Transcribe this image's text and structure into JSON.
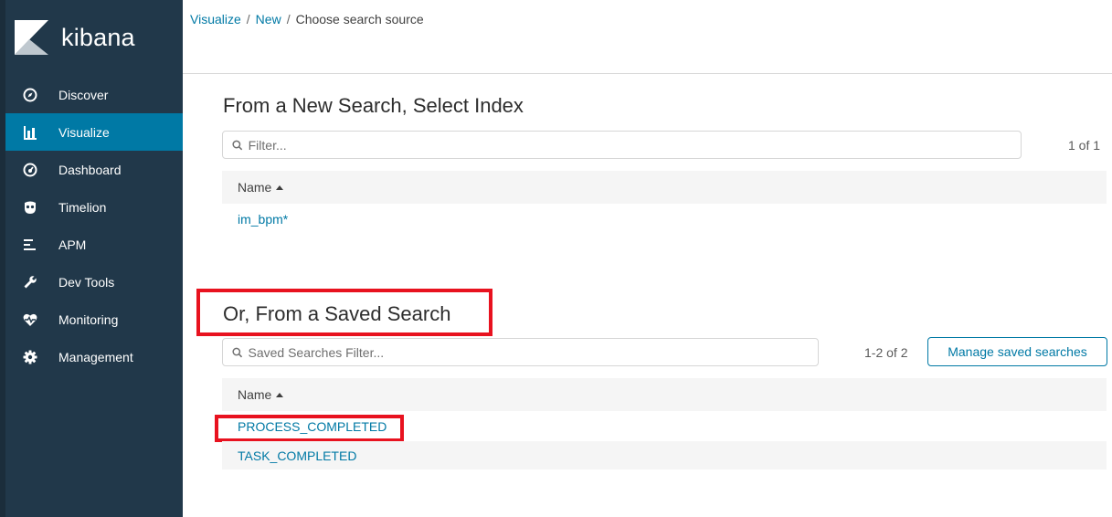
{
  "app": {
    "name": "kibana"
  },
  "sidebar": {
    "items": [
      {
        "label": "Discover",
        "icon": "compass-icon",
        "active": false
      },
      {
        "label": "Visualize",
        "icon": "bar-chart-icon",
        "active": true
      },
      {
        "label": "Dashboard",
        "icon": "dashboard-gauge-icon",
        "active": false
      },
      {
        "label": "Timelion",
        "icon": "timelion-mask-icon",
        "active": false
      },
      {
        "label": "APM",
        "icon": "apm-lines-icon",
        "active": false
      },
      {
        "label": "Dev Tools",
        "icon": "wrench-icon",
        "active": false
      },
      {
        "label": "Monitoring",
        "icon": "heartbeat-icon",
        "active": false
      },
      {
        "label": "Management",
        "icon": "gear-icon",
        "active": false
      }
    ]
  },
  "breadcrumb": {
    "items": [
      "Visualize",
      "New",
      "Choose search source"
    ],
    "separator": "/"
  },
  "new_search": {
    "title": "From a New Search, Select Index",
    "filter_placeholder": "Filter...",
    "count": "1 of 1",
    "column_header": "Name",
    "rows": [
      "im_bpm*"
    ]
  },
  "saved_search": {
    "title": "Or, From a Saved Search",
    "filter_placeholder": "Saved Searches Filter...",
    "count": "1-2 of 2",
    "manage_label": "Manage saved searches",
    "column_header": "Name",
    "rows": [
      "PROCESS_COMPLETED",
      "TASK_COMPLETED"
    ]
  },
  "colors": {
    "sidebar_bg": "#21384a",
    "sidebar_active": "#0079a5",
    "link": "#0079a5",
    "highlight": "#e8121f"
  }
}
